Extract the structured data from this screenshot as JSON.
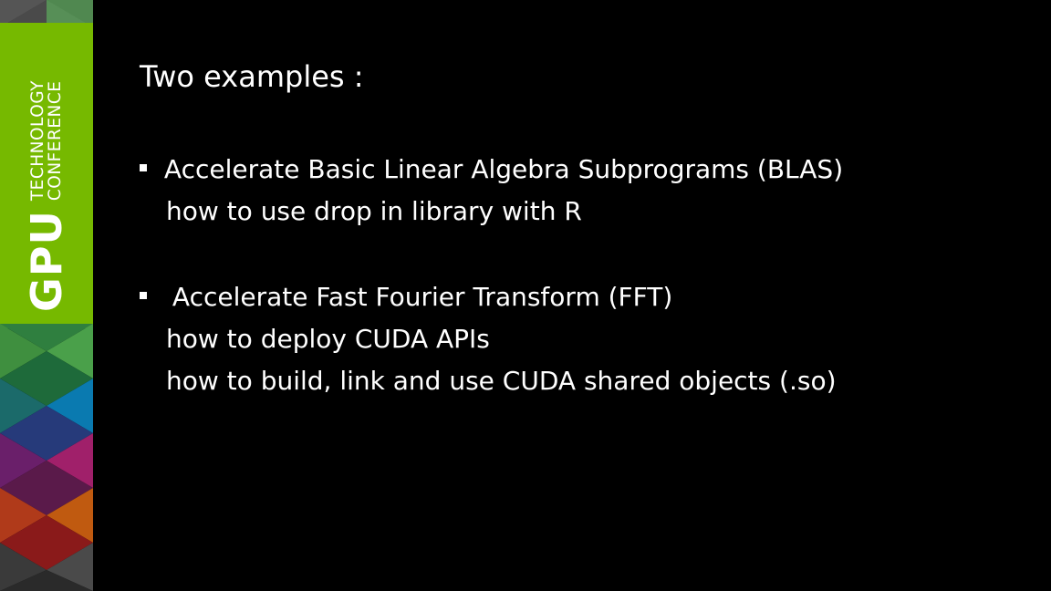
{
  "branding": {
    "gpu": "GPU",
    "line1": "TECHNOLOGY",
    "line2": "CONFERENCE",
    "accent_color": "#76b900"
  },
  "slide": {
    "title": "Two examples :",
    "bullets": [
      {
        "text": "Accelerate Basic Linear Algebra Subprograms (BLAS)",
        "sub": [
          "how to use drop in library with R"
        ]
      },
      {
        "text": "Accelerate Fast Fourier Transform (FFT)",
        "sub": [
          "how to deploy CUDA APIs",
          "how to build, link and use CUDA shared objects (.so)"
        ]
      }
    ]
  }
}
